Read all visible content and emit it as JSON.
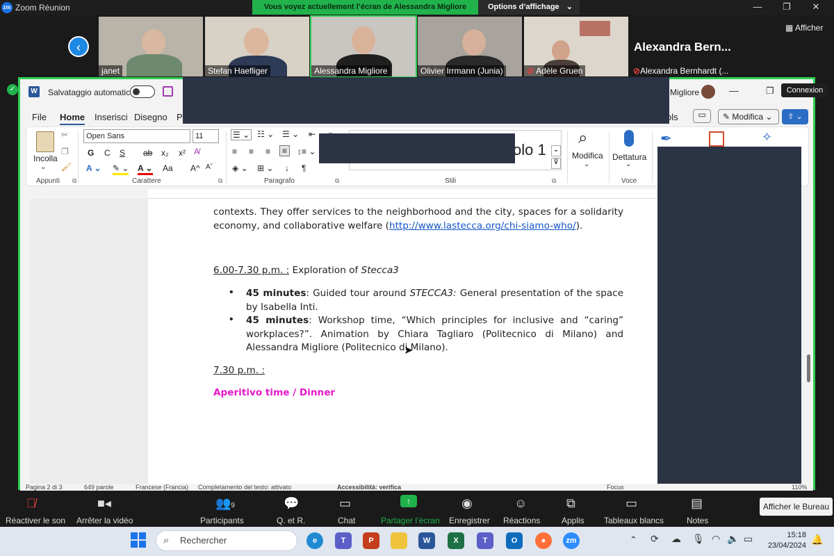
{
  "zoom_window": {
    "title": "Zoom Réunion",
    "share_banner": "Vous voyez actuellement l’écran de Alessandra Migliore",
    "view_options": "Options d’affichage",
    "show_label": "Afficher",
    "featured_name": "Alexandra  Bern..."
  },
  "participants": [
    {
      "name": "janet",
      "muted": false
    },
    {
      "name": "Stefan Haefliger",
      "muted": false
    },
    {
      "name": "Alessandra Migliore",
      "muted": false
    },
    {
      "name": "Olivier Irrmann (Junia)",
      "muted": false
    },
    {
      "name": "Adèle Gruen",
      "muted": true
    },
    {
      "name": "Alexandra Bernhardt (...",
      "muted": true
    }
  ],
  "word": {
    "autosave_label": "Salvataggio automatico",
    "user_suffix": "Migliore",
    "connexion_tooltip": "Connexion",
    "tabs": [
      "File",
      "Home",
      "Inserisci",
      "Disegno",
      "Pr"
    ],
    "tab_tail": "ols",
    "edit_mode": "Modifica",
    "font_name": "Open Sans",
    "font_size": "11",
    "style_partial": "olo 1",
    "groups": {
      "clipboard": "Appunti",
      "font": "Carattere",
      "paragraph": "Paragrafo",
      "styles": "Stili",
      "voice": "Voce"
    },
    "buttons": {
      "paste": "Incolla",
      "modify": "Modifica",
      "dictate": "Dettatura"
    },
    "font_tools": {
      "bold": "G",
      "italic": "C",
      "underline": "S",
      "strike": "ab",
      "subscript": "x₂",
      "superscript": "x²",
      "change_case": "Aa",
      "grow": "A",
      "shrink": "A",
      "pilcrow": "¶"
    },
    "status": {
      "page": "Pagina 2 di 3",
      "words": "649 parole",
      "language": "Francese (Francia)",
      "text_completion": "Completamento del testo: attivato",
      "accessibility": "Accessibilità: verifica",
      "focus": "Focus",
      "zoom": "110%"
    }
  },
  "document": {
    "p1": "contexts. They offer services to the neighborhood and the city, spaces for a solidarity economy, and collaborative welfare (",
    "p1_link": "http://www.lastecca.org/chi-siamo-who/",
    "p1_end": ").",
    "h1_time": "6.00-7.30 p.m. :",
    "h1_text": " Exploration of ",
    "h1_italic": "Stecca3",
    "b1_bold": "45 minutes",
    "b1_text": ": Guided tour around ",
    "b1_italic": "STECCA3:",
    "b1_rest": " General presentation of the space by Isabella Inti.",
    "b2_bold": "45 minutes",
    "b2_rest": ": Workshop time, “Which principles for inclusive and “caring” workplaces?”. Animation by Chiara Tagliaro (Politecnico di Milano) and Alessandra Migliore (Politecnico di Milano).",
    "h2_time": "7.30 p.m. :",
    "aperitivo": "Aperitivo time / Dinner",
    "aperitivo_color": "#e619c8"
  },
  "zoom_toolbar": {
    "items": [
      {
        "label": "Réactiver le son",
        "icon": "mic-muted-icon"
      },
      {
        "label": "Arrêter la vidéo",
        "icon": "video-icon"
      },
      {
        "label": "Participants",
        "icon": "participants-icon",
        "count": "9"
      },
      {
        "label": "Q. et R.",
        "icon": "qa-icon"
      },
      {
        "label": "Chat",
        "icon": "chat-icon"
      },
      {
        "label": "Partager l’écran",
        "icon": "share-screen-icon"
      },
      {
        "label": "Enregistrer",
        "icon": "record-icon"
      },
      {
        "label": "Réactions",
        "icon": "reactions-icon"
      },
      {
        "label": "Applis",
        "icon": "apps-icon"
      },
      {
        "label": "Tableaux blancs",
        "icon": "whiteboard-icon"
      },
      {
        "label": "Notes",
        "icon": "notes-icon"
      }
    ],
    "show_desktop": "Afficher le Bureau",
    "share_color": "#21b24c"
  },
  "taskbar": {
    "search_placeholder": "Rechercher",
    "time": "15:18",
    "date": "23/04/2024"
  }
}
